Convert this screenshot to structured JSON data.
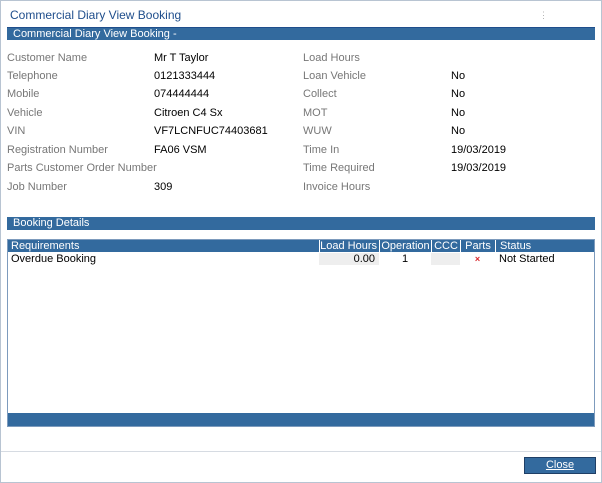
{
  "window": {
    "title": "Commercial Diary View Booking",
    "menu_dots": "⋮"
  },
  "booking_section": {
    "header": "Commercial Diary View Booking -",
    "left_fields": [
      {
        "label": "Customer Name",
        "value": "Mr T Taylor"
      },
      {
        "label": "Telephone",
        "value": "0121333444"
      },
      {
        "label": "Mobile",
        "value": "074444444"
      },
      {
        "label": "Vehicle",
        "value": "Citroen C4 Sx"
      },
      {
        "label": "VIN",
        "value": "VF7LCNFUC74403681"
      },
      {
        "label": "Registration Number",
        "value": "FA06 VSM"
      },
      {
        "label": "Parts Customer Order Number",
        "value": ""
      },
      {
        "label": "Job Number",
        "value": "309"
      }
    ],
    "right_fields": [
      {
        "label": "Load Hours",
        "value": ""
      },
      {
        "label": "Loan Vehicle",
        "value": "No"
      },
      {
        "label": "Collect",
        "value": "No"
      },
      {
        "label": "MOT",
        "value": "No"
      },
      {
        "label": "WUW",
        "value": "No"
      },
      {
        "label": "Time In",
        "value": "19/03/2019"
      },
      {
        "label": "Time Required",
        "value": "19/03/2019"
      },
      {
        "label": "Invoice Hours",
        "value": ""
      }
    ]
  },
  "booking_details": {
    "header": "Booking Details",
    "columns": [
      "Requirements",
      "Load Hours",
      "Operation",
      "CCC",
      "Parts",
      "Status"
    ],
    "rows": [
      {
        "requirements": "Overdue Booking",
        "load_hours": "0.00",
        "operation": "1",
        "ccc": "",
        "parts": "×",
        "status": "Not Started"
      }
    ]
  },
  "footer": {
    "close_label": "Close"
  },
  "colors": {
    "header_blue": "#336a9e",
    "title_blue": "#1f4e8c",
    "parts_x_red": "#d9252a"
  }
}
